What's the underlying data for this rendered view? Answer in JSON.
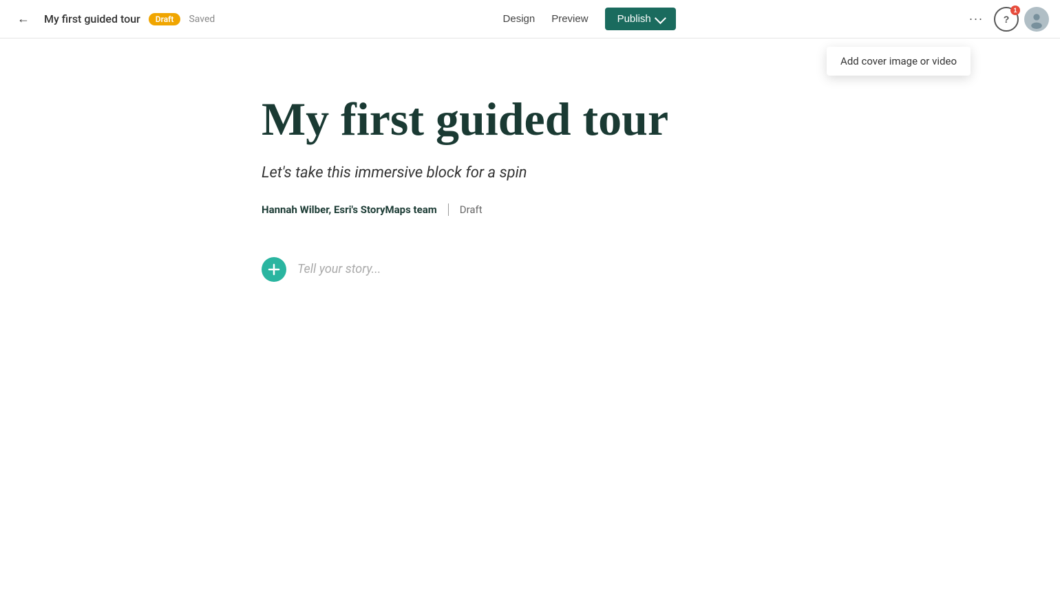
{
  "header": {
    "back_label": "←",
    "doc_title": "My first guided tour",
    "draft_badge": "Draft",
    "saved_label": "Saved",
    "design_label": "Design",
    "preview_label": "Preview",
    "publish_label": "Publish",
    "more_icon": "···",
    "help_icon": "?",
    "help_badge": "1"
  },
  "tooltip": {
    "label": "Add cover image or video"
  },
  "story": {
    "title": "My first guided tour",
    "subtitle": "Let's take this immersive block for a spin",
    "author": "Hannah Wilber, Esri's StoryMaps team",
    "status": "Draft",
    "placeholder": "Tell your story..."
  },
  "colors": {
    "publish_bg": "#1a6b5e",
    "draft_badge": "#f0a500",
    "add_block": "#2ab5a0",
    "title_color": "#1a3a33"
  }
}
